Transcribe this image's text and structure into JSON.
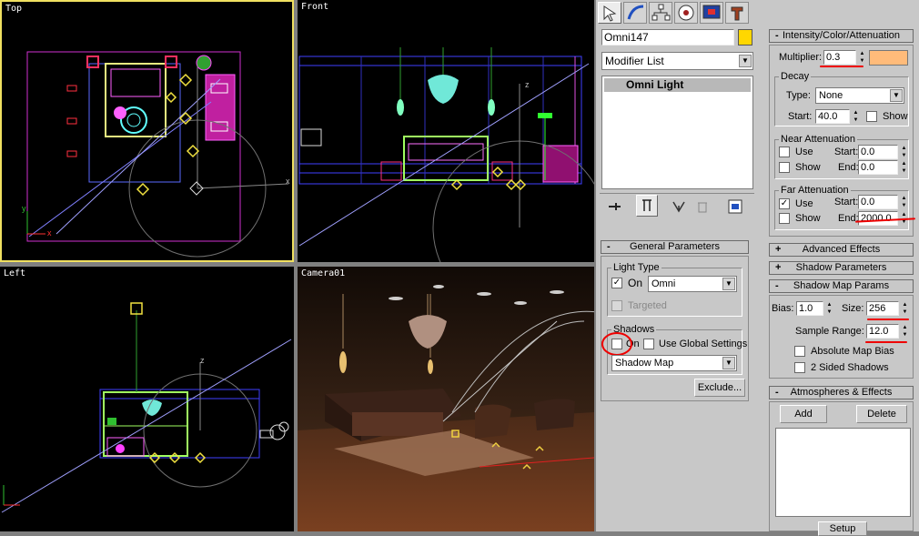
{
  "viewports": {
    "top": {
      "label": "Top"
    },
    "front": {
      "label": "Front"
    },
    "left": {
      "label": "Left"
    },
    "camera": {
      "label": "Camera01"
    }
  },
  "axes": {
    "x": "x",
    "y": "y",
    "z": "z"
  },
  "command_panel": {
    "tabs": [
      "create-icon",
      "modify-icon",
      "hierarchy-icon",
      "motion-icon",
      "display-icon",
      "utilities-icon"
    ],
    "object_name": "Omni147",
    "object_color": "#ffd700",
    "modifier_list_label": "Modifier List",
    "modifier_stack": [
      "Omni Light"
    ],
    "stack_tools": [
      "pin-stack-icon",
      "show-end-result-icon",
      "make-unique-icon",
      "remove-modifier-icon",
      "configure-modifier-sets-icon"
    ]
  },
  "general_parameters": {
    "title": "General Parameters",
    "light_type_group": "Light Type",
    "on_label": "On",
    "on_checked": true,
    "light_type_value": "Omni",
    "targeted_label": "Targeted",
    "shadows_group": "Shadows",
    "shadows_on_label": "On",
    "shadows_on_checked": false,
    "use_global_label": "Use Global Settings",
    "shadow_type_value": "Shadow Map",
    "exclude_label": "Exclude..."
  },
  "intensity": {
    "title": "Intensity/Color/Attenuation",
    "multiplier_label": "Multiplier:",
    "multiplier_value": "0.3",
    "light_color": "#ffbb7a",
    "decay_group": "Decay",
    "type_label": "Type:",
    "type_value": "None",
    "start_label": "Start:",
    "start_value": "40.0",
    "show_label": "Show",
    "near_group": "Near Attenuation",
    "near_use_label": "Use",
    "near_show_label": "Show",
    "near_start_label": "Start:",
    "near_start_value": "0.0",
    "near_end_label": "End:",
    "near_end_value": "0.0",
    "far_group": "Far Attenuation",
    "far_use_label": "Use",
    "far_use_checked": true,
    "far_show_label": "Show",
    "far_start_label": "Start:",
    "far_start_value": "0.0",
    "far_end_label": "End:",
    "far_end_value": "2000.0"
  },
  "rollouts": {
    "advanced_effects": "Advanced Effects",
    "shadow_parameters": "Shadow Parameters",
    "shadow_map_params": "Shadow Map Params",
    "atmospheres": "Atmospheres & Effects"
  },
  "shadow_map": {
    "bias_label": "Bias:",
    "bias_value": "1.0",
    "size_label": "Size:",
    "size_value": "256",
    "sample_range_label": "Sample Range:",
    "sample_range_value": "12.0",
    "absolute_bias_label": "Absolute Map Bias",
    "two_sided_label": "2 Sided Shadows"
  },
  "atmospheres": {
    "add_label": "Add",
    "delete_label": "Delete",
    "setup_label": "Setup"
  },
  "check_mark": "✓",
  "expanded_sign": "-",
  "collapsed_sign": "+",
  "dropdown_arrow": "▼",
  "spin_up": "▲",
  "spin_down": "▼"
}
